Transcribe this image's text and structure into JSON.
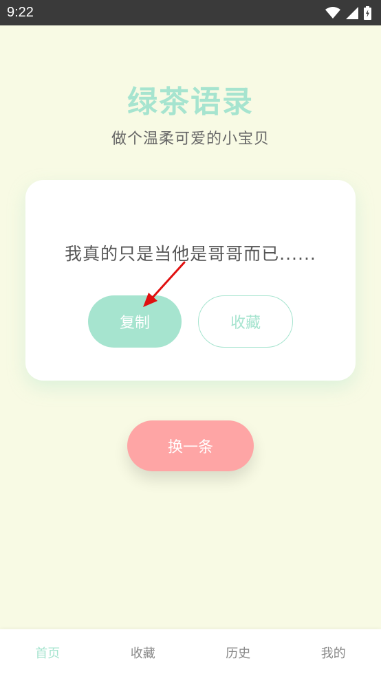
{
  "status_bar": {
    "time": "9:22",
    "icons": [
      "wifi-icon",
      "signal-icon",
      "battery-charging-icon"
    ]
  },
  "header": {
    "title": "绿茶语录",
    "subtitle": "做个温柔可爱的小宝贝"
  },
  "quote_card": {
    "text": "我真的只是当他是哥哥而已......",
    "copy_label": "复制",
    "favorite_label": "收藏"
  },
  "next_button": {
    "label": "换一条"
  },
  "bottom_nav": {
    "items": [
      {
        "label": "首页",
        "active": true
      },
      {
        "label": "收藏",
        "active": false
      },
      {
        "label": "历史",
        "active": false
      },
      {
        "label": "我的",
        "active": false
      }
    ]
  },
  "colors": {
    "background": "#F8FAE4",
    "accent_green": "#A6E4CF",
    "accent_pink": "#FEA5A5",
    "status_bar": "#3A3A3A",
    "annotation_arrow": "#E01010"
  }
}
